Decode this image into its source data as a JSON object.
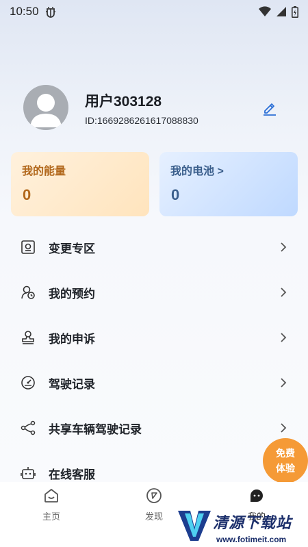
{
  "status_bar": {
    "time": "10:50"
  },
  "profile": {
    "username": "用户303128",
    "user_id": "ID:1669286261617088830"
  },
  "cards": {
    "energy": {
      "title": "我的能量",
      "value": "0"
    },
    "battery": {
      "title": "我的电池 >",
      "value": "0"
    }
  },
  "menu": [
    {
      "label": "变更专区",
      "icon": "exchange-zone-icon"
    },
    {
      "label": "我的预约",
      "icon": "reservation-icon"
    },
    {
      "label": "我的申诉",
      "icon": "appeal-stamp-icon"
    },
    {
      "label": "驾驶记录",
      "icon": "speedometer-icon"
    },
    {
      "label": "共享车辆驾驶记录",
      "icon": "share-icon"
    },
    {
      "label": "在线客服",
      "icon": "customer-service-icon"
    }
  ],
  "float_button": {
    "line1": "免费",
    "line2": "体验"
  },
  "tabs": [
    {
      "label": "主页"
    },
    {
      "label": "发现"
    },
    {
      "label": "我的"
    }
  ],
  "watermark": {
    "text": "清源下载站",
    "url": "www.fotimeit.com"
  },
  "colors": {
    "accent": "#2b6fd6",
    "float_button": "#f59a36",
    "energy_text": "#b2681c",
    "battery_text": "#3b5f8c"
  }
}
